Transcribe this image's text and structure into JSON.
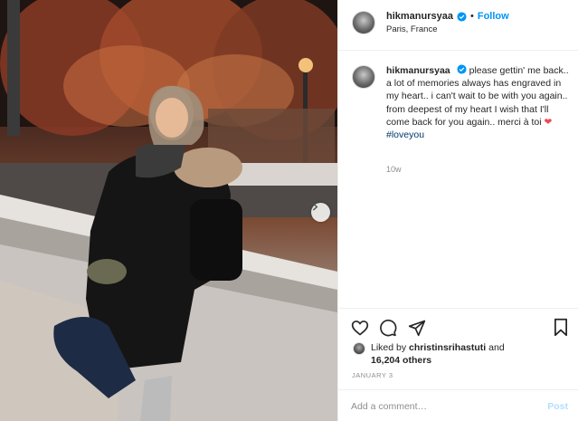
{
  "post": {
    "username": "hikmanursyaa",
    "follow_label": "Follow",
    "dot": "•",
    "location": "Paris, France",
    "caption": {
      "username": "hikmanursyaa",
      "text": "please gettin' me back.. a lot of memories always has engraved in my heart.. i can't wait to be with you again.. from deepest of my heart I wish that I'll come back for you again.. merci à toi",
      "emoji": "❤",
      "hashtag": "#loveyou"
    },
    "time_ago": "10w",
    "likes": {
      "prefix": "Liked by",
      "user": "christinsrihastuti",
      "and": "and",
      "count": "16,204 others"
    },
    "date": "JANUARY 3",
    "comment": {
      "placeholder": "Add a comment…",
      "post_label": "Post"
    }
  },
  "colors": {
    "accent": "#0095f6",
    "hashtag": "#00376b",
    "muted": "#8e8e8e",
    "heart": "#ed4956"
  },
  "icons": [
    "verified-badge-icon",
    "heart-icon",
    "comment-icon",
    "share-icon",
    "bookmark-icon",
    "chevron-right-icon"
  ]
}
